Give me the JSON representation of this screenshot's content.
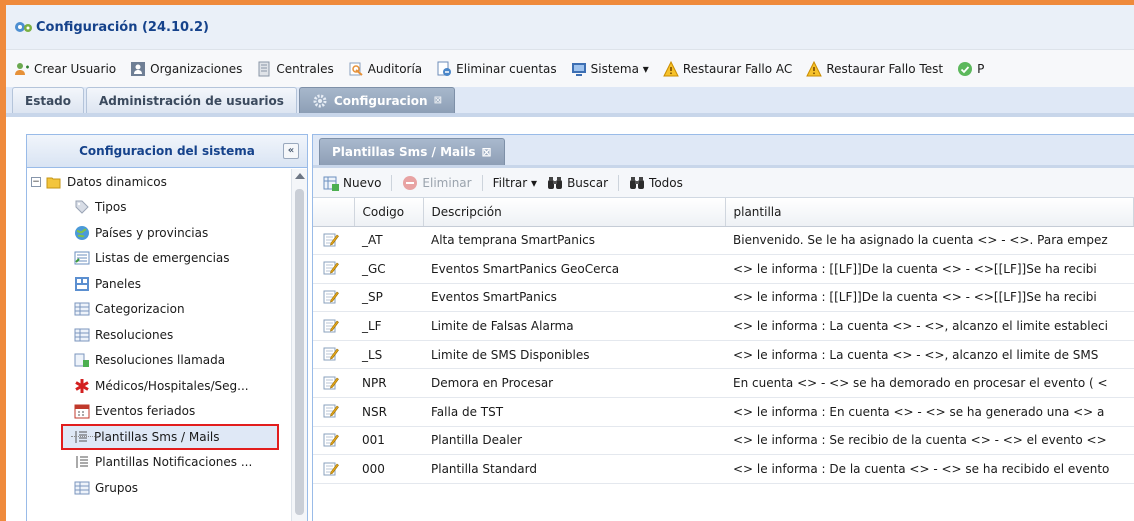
{
  "window": {
    "title": "Configuración (24.10.2)"
  },
  "toolbar": {
    "items": [
      {
        "label": "Crear Usuario",
        "icon": "add-user-icon"
      },
      {
        "label": "Organizaciones",
        "icon": "organization-icon"
      },
      {
        "label": "Centrales",
        "icon": "central-icon"
      },
      {
        "label": "Auditoría",
        "icon": "audit-icon"
      },
      {
        "label": "Eliminar cuentas",
        "icon": "delete-accounts-icon"
      },
      {
        "label": "Sistema ▾",
        "icon": "system-icon"
      },
      {
        "label": "Restaurar Fallo AC",
        "icon": "warning-icon"
      },
      {
        "label": "Restaurar Fallo Test",
        "icon": "warning-icon"
      },
      {
        "label": "P",
        "icon": "check-icon"
      }
    ]
  },
  "main_tabs": [
    {
      "label": "Estado"
    },
    {
      "label": "Administración de usuarios"
    },
    {
      "label": "Configuracion",
      "close": "⊠"
    }
  ],
  "left_panel": {
    "title": "Configuracion del sistema",
    "collapse_glyph": "«",
    "root": {
      "label": "Datos dinamicos",
      "expander": "−"
    },
    "items": [
      {
        "label": "Tipos"
      },
      {
        "label": "Países y provincias"
      },
      {
        "label": "Listas de emergencias"
      },
      {
        "label": "Paneles"
      },
      {
        "label": "Categorizacion"
      },
      {
        "label": "Resoluciones"
      },
      {
        "label": "Resoluciones llamada"
      },
      {
        "label": "Médicos/Hospitales/Seg..."
      },
      {
        "label": "Eventos feriados"
      },
      {
        "label": "Plantillas Sms / Mails"
      },
      {
        "label": "Plantillas Notificaciones ..."
      },
      {
        "label": "Grupos"
      }
    ]
  },
  "right_panel": {
    "tab_label": "Plantillas Sms / Mails",
    "tab_close": "⊠",
    "grid_toolbar": {
      "nuevo": "Nuevo",
      "eliminar": "Eliminar",
      "filtrar": "Filtrar ▾",
      "buscar": "Buscar",
      "todos": "Todos"
    },
    "columns": [
      "Codigo",
      "Descripción",
      "plantilla"
    ],
    "rows": [
      {
        "codigo": "_AT",
        "descripcion": "Alta temprana SmartPanics",
        "plantilla": "Bienvenido. Se le ha asignado la cuenta <> - <>. Para empez"
      },
      {
        "codigo": "_GC",
        "descripcion": "Eventos SmartPanics GeoCerca",
        "plantilla": "<> le informa : [[LF]]De la cuenta <> - <>[[LF]]Se ha recibi"
      },
      {
        "codigo": "_SP",
        "descripcion": "Eventos SmartPanics",
        "plantilla": "<> le informa : [[LF]]De la cuenta <> - <>[[LF]]Se ha recibi"
      },
      {
        "codigo": "_LF",
        "descripcion": "Limite de Falsas Alarma",
        "plantilla": "<> le informa : La cuenta <> - <>, alcanzo el limite estableci"
      },
      {
        "codigo": "_LS",
        "descripcion": "Limite de SMS Disponibles",
        "plantilla": "<> le informa : La cuenta <> - <>, alcanzo el limite de SMS"
      },
      {
        "codigo": "NPR",
        "descripcion": "Demora en Procesar",
        "plantilla": "En cuenta <> - <> se ha demorado en procesar el evento ( <"
      },
      {
        "codigo": "NSR",
        "descripcion": "Falla de TST",
        "plantilla": "<> le informa : En cuenta <> - <> se ha generado una <> a"
      },
      {
        "codigo": "001",
        "descripcion": "Plantilla Dealer",
        "plantilla": "<> le informa : Se recibio de la cuenta <> - <> el evento <>"
      },
      {
        "codigo": "000",
        "descripcion": "Plantilla Standard",
        "plantilla": "<> le informa : De la cuenta <> - <> se ha recibido el evento"
      }
    ]
  },
  "colors": {
    "accent_border": "#ef8a3c",
    "selection_outline": "#e21d1d",
    "header_text": "#15428b"
  }
}
